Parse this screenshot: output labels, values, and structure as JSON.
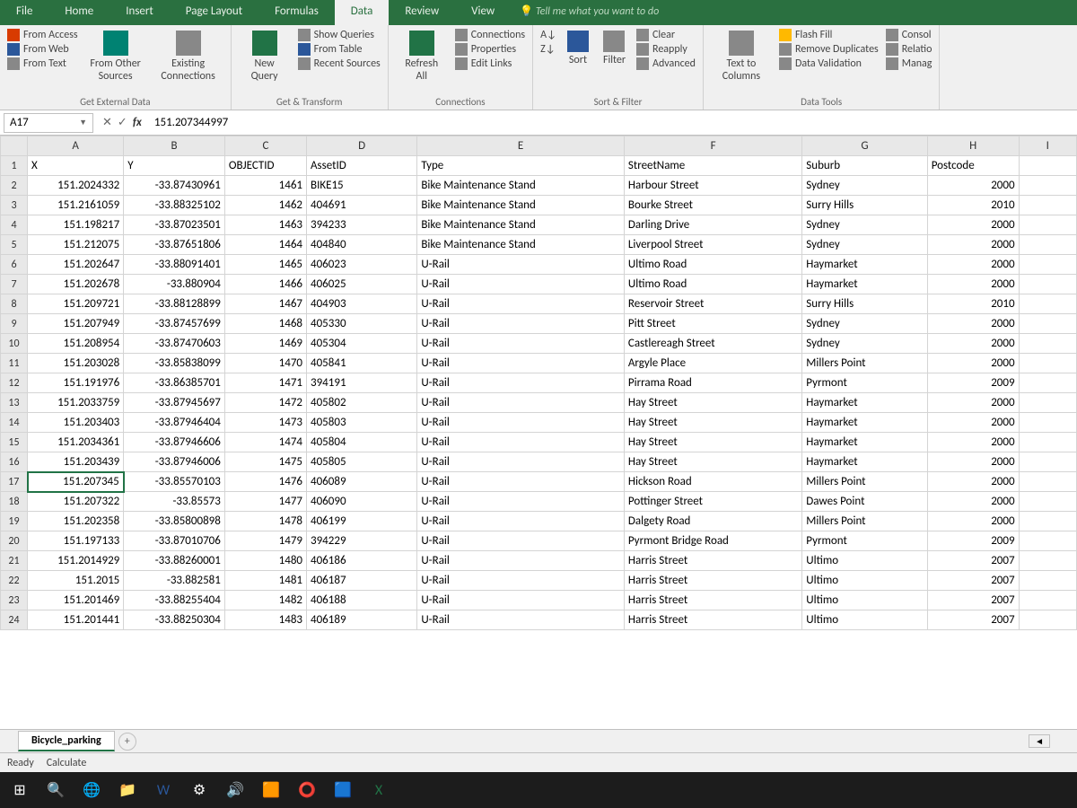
{
  "menu": {
    "tabs": [
      "File",
      "Home",
      "Insert",
      "Page Layout",
      "Formulas",
      "Data",
      "Review",
      "View"
    ],
    "active": "Data",
    "tellme": "Tell me what you want to do"
  },
  "ribbon": {
    "groups": {
      "getdata": {
        "label": "Get External Data",
        "from_access": "From Access",
        "from_web": "From Web",
        "from_text": "From Text",
        "from_other": "From Other Sources",
        "existing": "Existing Connections"
      },
      "transform": {
        "label": "Get & Transform",
        "new_query": "New Query",
        "show_queries": "Show Queries",
        "from_table": "From Table",
        "recent": "Recent Sources"
      },
      "connections": {
        "label": "Connections",
        "refresh": "Refresh All",
        "conns": "Connections",
        "props": "Properties",
        "edit": "Edit Links"
      },
      "sortfilter": {
        "label": "Sort & Filter",
        "sort_az": "A→Z",
        "sort_za": "Z→A",
        "sort": "Sort",
        "filter": "Filter",
        "clear": "Clear",
        "reapply": "Reapply",
        "advanced": "Advanced"
      },
      "datatools": {
        "label": "Data Tools",
        "ttc": "Text to Columns",
        "flash": "Flash Fill",
        "dupes": "Remove Duplicates",
        "valid": "Data Validation",
        "consol": "Consol",
        "relat": "Relatio",
        "manage": "Manag"
      }
    }
  },
  "formula_bar": {
    "namebox": "A17",
    "formula": "151.207344997"
  },
  "grid": {
    "columns": [
      "A",
      "B",
      "C",
      "D",
      "E",
      "F",
      "G",
      "H",
      "I"
    ],
    "headers": {
      "A": "X",
      "B": "Y",
      "C": "OBJECTID",
      "D": "AssetID",
      "E": "Type",
      "F": "StreetName",
      "G": "Suburb",
      "H": "Postcode"
    },
    "active_cell": "A17",
    "rows": [
      {
        "n": 2,
        "A": "151.2024332",
        "B": "-33.87430961",
        "C": "1461",
        "D": "BIKE15",
        "E": "Bike Maintenance Stand",
        "F": "Harbour Street",
        "G": "Sydney",
        "H": "2000"
      },
      {
        "n": 3,
        "A": "151.2161059",
        "B": "-33.88325102",
        "C": "1462",
        "D": "404691",
        "E": "Bike Maintenance Stand",
        "F": "Bourke Street",
        "G": "Surry Hills",
        "H": "2010"
      },
      {
        "n": 4,
        "A": "151.198217",
        "B": "-33.87023501",
        "C": "1463",
        "D": "394233",
        "E": "Bike Maintenance Stand",
        "F": "Darling Drive",
        "G": "Sydney",
        "H": "2000"
      },
      {
        "n": 5,
        "A": "151.212075",
        "B": "-33.87651806",
        "C": "1464",
        "D": "404840",
        "E": "Bike Maintenance Stand",
        "F": "Liverpool Street",
        "G": "Sydney",
        "H": "2000"
      },
      {
        "n": 6,
        "A": "151.202647",
        "B": "-33.88091401",
        "C": "1465",
        "D": "406023",
        "E": "U-Rail",
        "F": "Ultimo Road",
        "G": "Haymarket",
        "H": "2000"
      },
      {
        "n": 7,
        "A": "151.202678",
        "B": "-33.880904",
        "C": "1466",
        "D": "406025",
        "E": "U-Rail",
        "F": "Ultimo Road",
        "G": "Haymarket",
        "H": "2000"
      },
      {
        "n": 8,
        "A": "151.209721",
        "B": "-33.88128899",
        "C": "1467",
        "D": "404903",
        "E": "U-Rail",
        "F": "Reservoir Street",
        "G": "Surry Hills",
        "H": "2010"
      },
      {
        "n": 9,
        "A": "151.207949",
        "B": "-33.87457699",
        "C": "1468",
        "D": "405330",
        "E": "U-Rail",
        "F": "Pitt Street",
        "G": "Sydney",
        "H": "2000"
      },
      {
        "n": 10,
        "A": "151.208954",
        "B": "-33.87470603",
        "C": "1469",
        "D": "405304",
        "E": "U-Rail",
        "F": "Castlereagh Street",
        "G": "Sydney",
        "H": "2000"
      },
      {
        "n": 11,
        "A": "151.203028",
        "B": "-33.85838099",
        "C": "1470",
        "D": "405841",
        "E": "U-Rail",
        "F": "Argyle Place",
        "G": "Millers Point",
        "H": "2000"
      },
      {
        "n": 12,
        "A": "151.191976",
        "B": "-33.86385701",
        "C": "1471",
        "D": "394191",
        "E": "U-Rail",
        "F": "Pirrama Road",
        "G": "Pyrmont",
        "H": "2009"
      },
      {
        "n": 13,
        "A": "151.2033759",
        "B": "-33.87945697",
        "C": "1472",
        "D": "405802",
        "E": "U-Rail",
        "F": "Hay Street",
        "G": "Haymarket",
        "H": "2000"
      },
      {
        "n": 14,
        "A": "151.203403",
        "B": "-33.87946404",
        "C": "1473",
        "D": "405803",
        "E": "U-Rail",
        "F": "Hay Street",
        "G": "Haymarket",
        "H": "2000"
      },
      {
        "n": 15,
        "A": "151.2034361",
        "B": "-33.87946606",
        "C": "1474",
        "D": "405804",
        "E": "U-Rail",
        "F": "Hay Street",
        "G": "Haymarket",
        "H": "2000"
      },
      {
        "n": 16,
        "A": "151.203439",
        "B": "-33.87946006",
        "C": "1475",
        "D": "405805",
        "E": "U-Rail",
        "F": "Hay Street",
        "G": "Haymarket",
        "H": "2000"
      },
      {
        "n": 17,
        "A": "151.207345",
        "B": "-33.85570103",
        "C": "1476",
        "D": "406089",
        "E": "U-Rail",
        "F": "Hickson Road",
        "G": "Millers Point",
        "H": "2000"
      },
      {
        "n": 18,
        "A": "151.207322",
        "B": "-33.85573",
        "C": "1477",
        "D": "406090",
        "E": "U-Rail",
        "F": "Pottinger Street",
        "G": "Dawes Point",
        "H": "2000"
      },
      {
        "n": 19,
        "A": "151.202358",
        "B": "-33.85800898",
        "C": "1478",
        "D": "406199",
        "E": "U-Rail",
        "F": "Dalgety Road",
        "G": "Millers Point",
        "H": "2000"
      },
      {
        "n": 20,
        "A": "151.197133",
        "B": "-33.87010706",
        "C": "1479",
        "D": "394229",
        "E": "U-Rail",
        "F": "Pyrmont Bridge Road",
        "G": "Pyrmont",
        "H": "2009"
      },
      {
        "n": 21,
        "A": "151.2014929",
        "B": "-33.88260001",
        "C": "1480",
        "D": "406186",
        "E": "U-Rail",
        "F": "Harris Street",
        "G": "Ultimo",
        "H": "2007"
      },
      {
        "n": 22,
        "A": "151.2015",
        "B": "-33.882581",
        "C": "1481",
        "D": "406187",
        "E": "U-Rail",
        "F": "Harris Street",
        "G": "Ultimo",
        "H": "2007"
      },
      {
        "n": 23,
        "A": "151.201469",
        "B": "-33.88255404",
        "C": "1482",
        "D": "406188",
        "E": "U-Rail",
        "F": "Harris Street",
        "G": "Ultimo",
        "H": "2007"
      },
      {
        "n": 24,
        "A": "151.201441",
        "B": "-33.88250304",
        "C": "1483",
        "D": "406189",
        "E": "U-Rail",
        "F": "Harris Street",
        "G": "Ultimo",
        "H": "2007"
      }
    ]
  },
  "sheet": {
    "name": "Bicycle_parking",
    "add": "+"
  },
  "status": {
    "ready": "Ready",
    "calc": "Calculate"
  }
}
